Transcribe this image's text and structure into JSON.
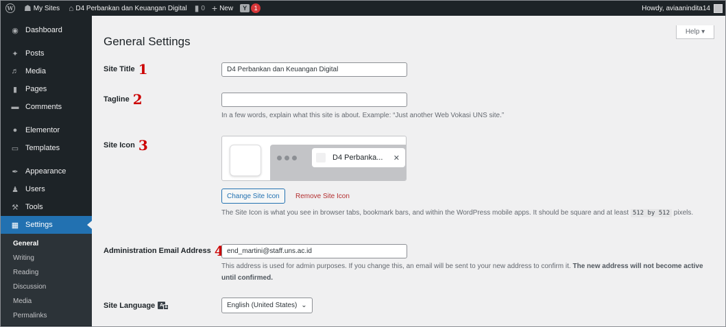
{
  "adminbar": {
    "my_sites": "My Sites",
    "site_name": "D4 Perbankan dan Keuangan Digital",
    "comments_count": "0",
    "new_label": "New",
    "updates_badge": "1",
    "howdy": "Howdy, aviaanindita14"
  },
  "sidebar": {
    "items": [
      {
        "label": "Dashboard",
        "icon": "dashboard-icon"
      },
      {
        "label": "Posts",
        "icon": "pin-icon"
      },
      {
        "label": "Media",
        "icon": "media-icon"
      },
      {
        "label": "Pages",
        "icon": "pages-icon"
      },
      {
        "label": "Comments",
        "icon": "comment-icon"
      },
      {
        "label": "Elementor",
        "icon": "elementor-icon"
      },
      {
        "label": "Templates",
        "icon": "folder-icon"
      },
      {
        "label": "Appearance",
        "icon": "brush-icon"
      },
      {
        "label": "Users",
        "icon": "users-icon"
      },
      {
        "label": "Tools",
        "icon": "wrench-icon"
      },
      {
        "label": "Settings",
        "icon": "settings-icon"
      }
    ],
    "submenu": [
      "General",
      "Writing",
      "Reading",
      "Discussion",
      "Media",
      "Permalinks"
    ]
  },
  "help_tab": "Help ▾",
  "page_title": "General Settings",
  "markers": [
    "1",
    "2",
    "3",
    "4"
  ],
  "fields": {
    "site_title": {
      "label": "Site Title",
      "value": "D4 Perbankan dan Keuangan Digital"
    },
    "tagline": {
      "label": "Tagline",
      "value": "",
      "description": "In a few words, explain what this site is about. Example: “Just another Web Vokasi UNS site.”"
    },
    "site_icon": {
      "label": "Site Icon",
      "preview_tab_text": "D4 Perbanka...",
      "change_button": "Change Site Icon",
      "remove_link": "Remove Site Icon",
      "description_before": "The Site Icon is what you see in browser tabs, bookmark bars, and within the WordPress mobile apps. It should be square and at least",
      "description_code": "512 by 512",
      "description_after": "pixels."
    },
    "admin_email": {
      "label": "Administration Email Address",
      "value": "end_martini@staff.uns.ac.id",
      "description": "This address is used for admin purposes. If you change this, an email will be sent to your new address to confirm it.",
      "description_bold": "The new address will not become active until confirmed."
    },
    "site_language": {
      "label": "Site Language",
      "value": "English (United States)"
    }
  },
  "colors": {
    "admin_dark": "#1d2327",
    "accent": "#2271b1",
    "marker_red": "#cc0000",
    "background": "#f0f0f1"
  }
}
